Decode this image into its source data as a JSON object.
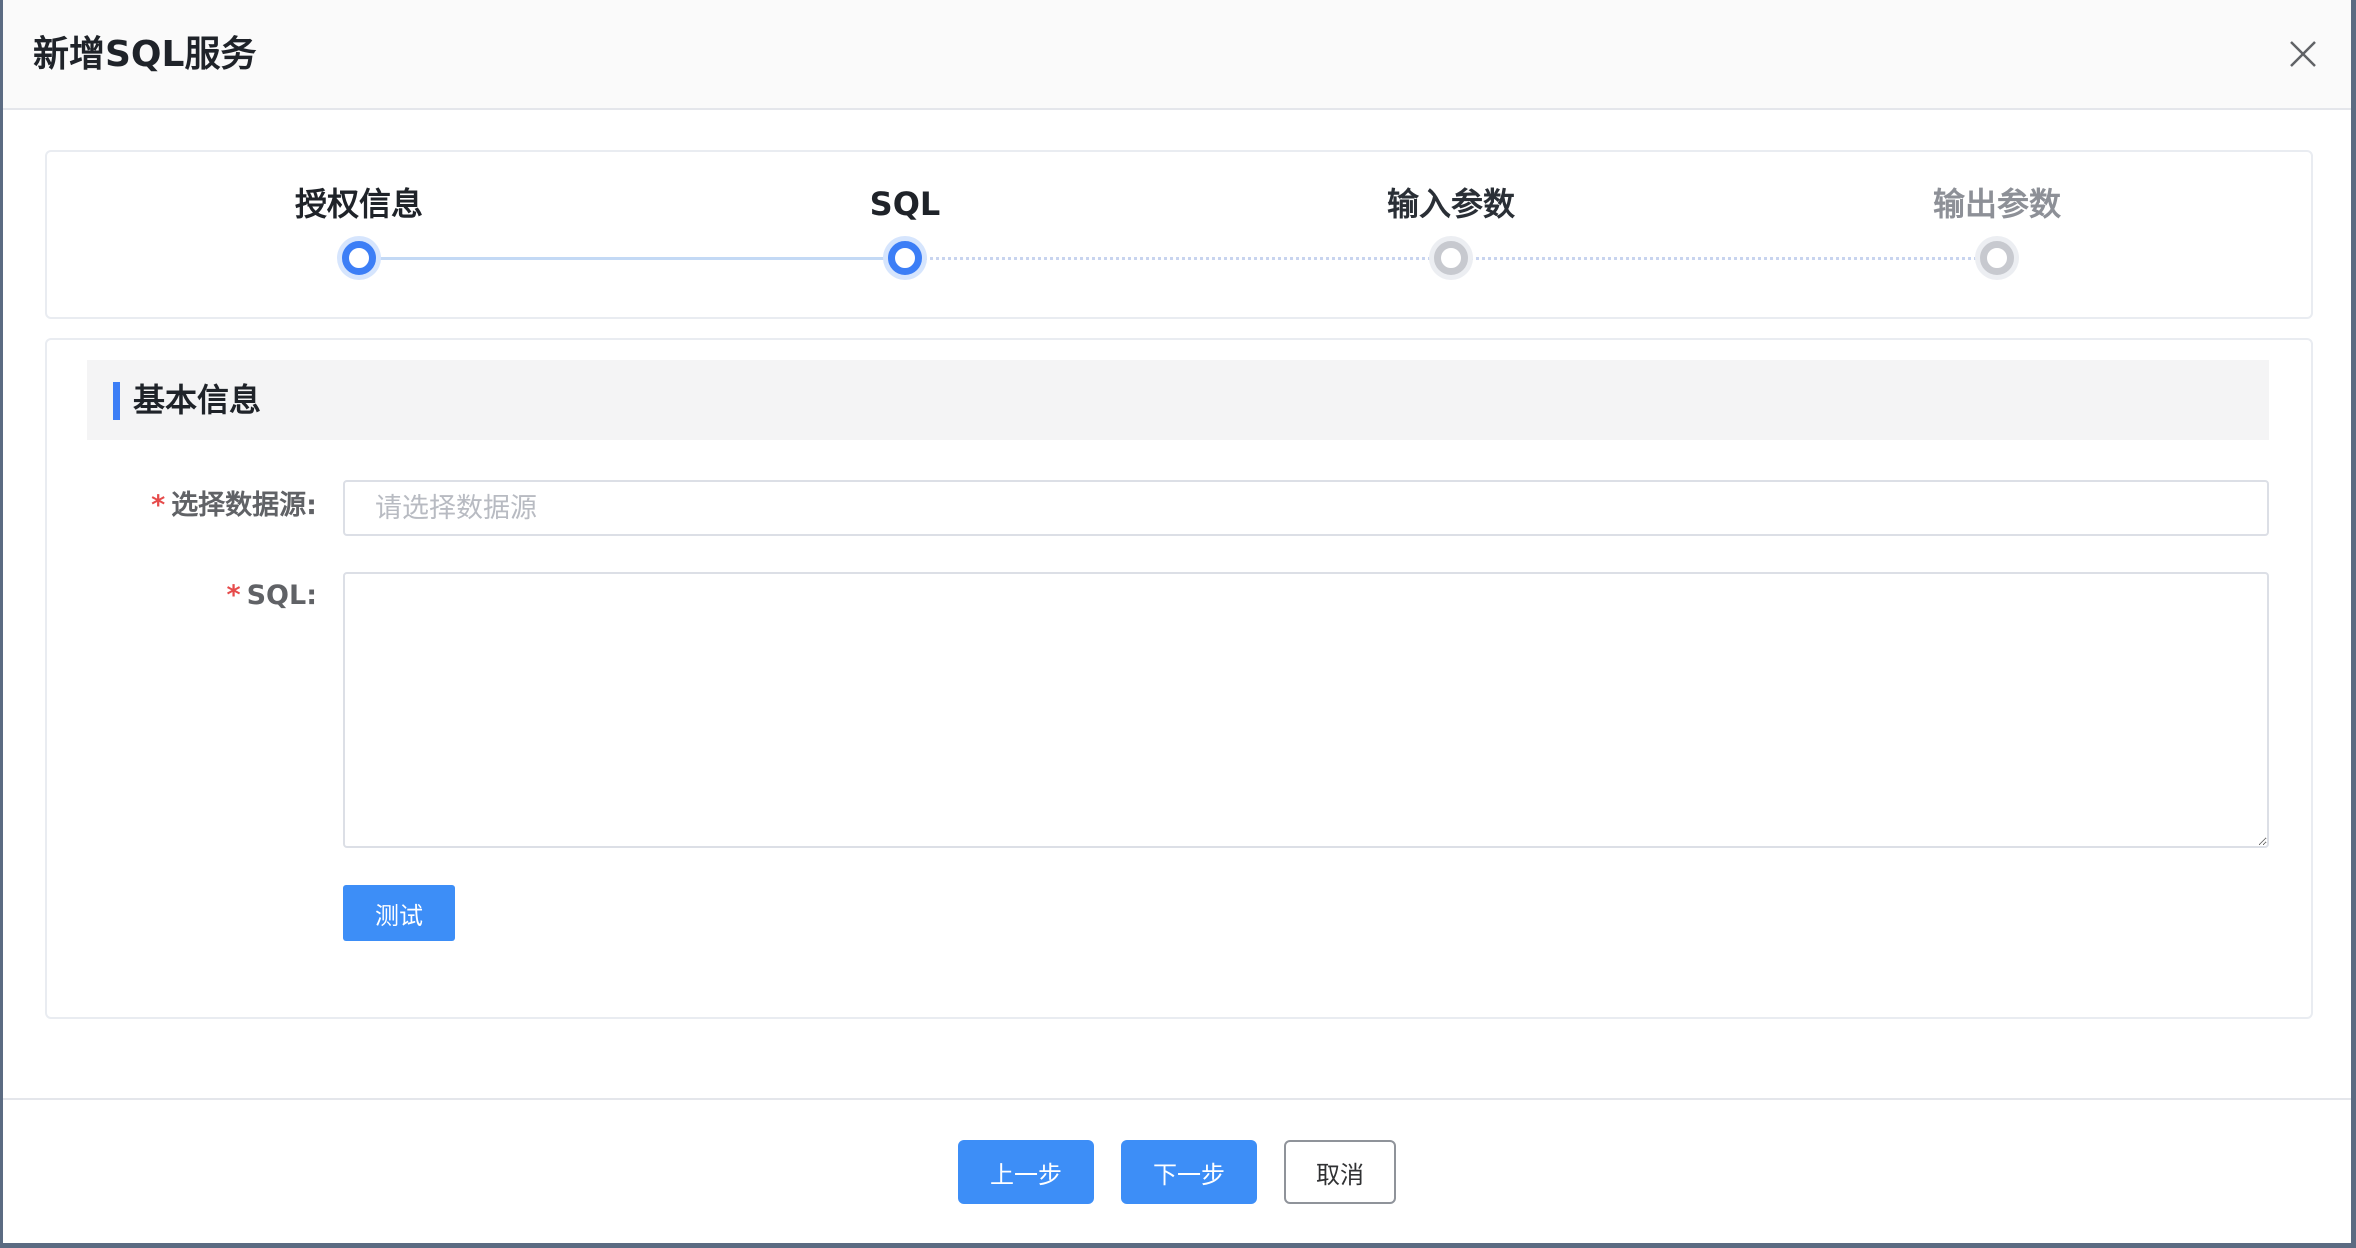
{
  "dialog": {
    "title": "新增SQL服务",
    "close_icon": "close-icon"
  },
  "steps": [
    {
      "label": "授权信息",
      "state": "done"
    },
    {
      "label": "SQL",
      "state": "active"
    },
    {
      "label": "输入参数",
      "state": "pending"
    },
    {
      "label": "输出参数",
      "state": "pending"
    }
  ],
  "section": {
    "title": "基本信息"
  },
  "form": {
    "datasource_label": "选择数据源:",
    "datasource_placeholder": "请选择数据源",
    "datasource_value": "",
    "sql_label": "SQL:",
    "sql_value": "",
    "required_mark": "*",
    "test_button": "测试"
  },
  "footer": {
    "prev_button": "上一步",
    "next_button": "下一步",
    "cancel_button": "取消"
  },
  "colors": {
    "primary": "#3d8ef7",
    "step_active": "#3c7ef6",
    "step_pending": "#c7c9cf",
    "required": "#e64b4b"
  }
}
